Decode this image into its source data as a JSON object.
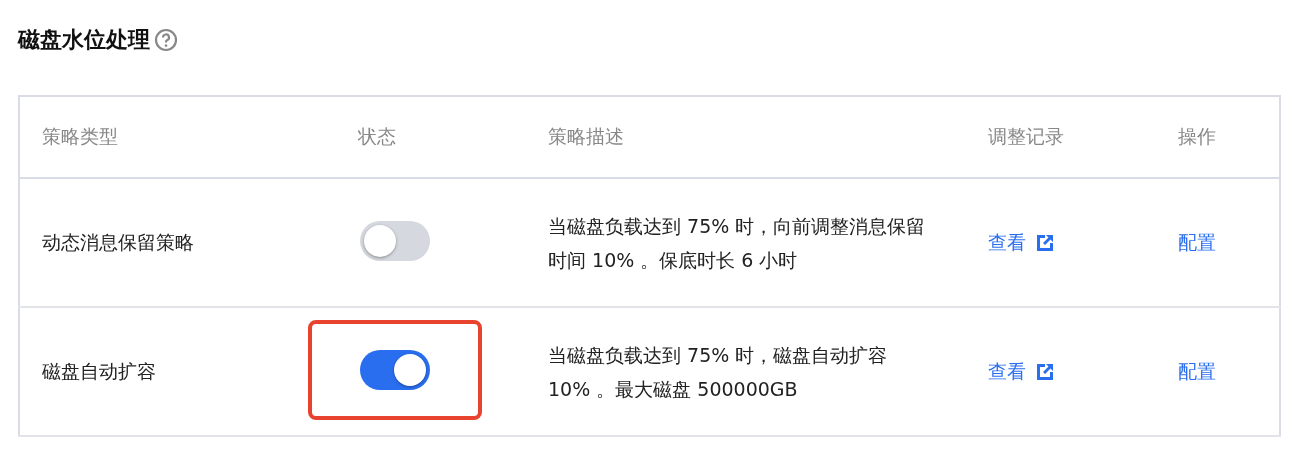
{
  "title": "磁盘水位处理",
  "table": {
    "columns": [
      "策略类型",
      "状态",
      "策略描述",
      "调整记录",
      "操作"
    ],
    "rows": [
      {
        "type": "动态消息保留策略",
        "on": false,
        "highlighted": false,
        "description": "当磁盘负载达到 75% 时，向前调整消息保留时间 10% 。保底时长 6 小时",
        "record": "查看",
        "action": "配置"
      },
      {
        "type": "磁盘自动扩容",
        "on": true,
        "highlighted": true,
        "description": "当磁盘负载达到 75% 时，磁盘自动扩容 10% 。最大磁盘 500000GB",
        "record": "查看",
        "action": "配置"
      }
    ]
  }
}
